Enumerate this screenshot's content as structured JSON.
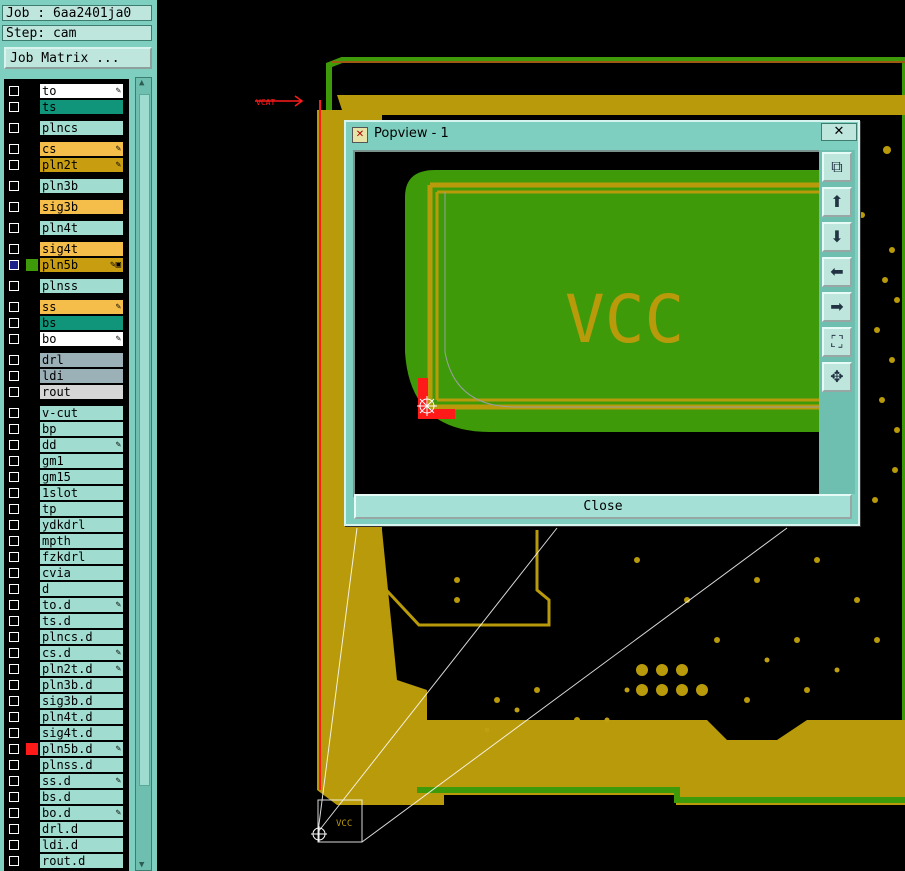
{
  "job_label": "Job : 6aa2401ja0",
  "step_label": "Step: cam",
  "job_matrix_button": "Job Matrix ...",
  "layers": [
    {
      "name": "to",
      "color": "#ffffff",
      "swatch": "",
      "flag": "✎"
    },
    {
      "name": "ts",
      "color": "#10957a",
      "swatch": "",
      "flag": ""
    },
    {
      "name": "plncs",
      "color": "#a0dcd0",
      "swatch": "",
      "flag": ""
    },
    {
      "name": "cs",
      "color": "#f5be4b",
      "swatch": "",
      "flag": "✎"
    },
    {
      "name": "pln2t",
      "color": "#c99d10",
      "swatch": "",
      "flag": "✎"
    },
    {
      "name": "pln3b",
      "color": "#a0dcd0",
      "swatch": "",
      "flag": ""
    },
    {
      "name": "sig3b",
      "color": "#f5be4b",
      "swatch": "",
      "flag": ""
    },
    {
      "name": "pln4t",
      "color": "#a0dcd0",
      "swatch": "",
      "flag": ""
    },
    {
      "name": "sig4t",
      "color": "#f5be4b",
      "swatch": "",
      "flag": ""
    },
    {
      "name": "pln5b",
      "color": "#c99d10",
      "swatch": "#3f9a0a",
      "flag": "✎▣",
      "selected": true
    },
    {
      "name": "plnss",
      "color": "#a0dcd0",
      "swatch": "",
      "flag": ""
    },
    {
      "name": "ss",
      "color": "#f5be4b",
      "swatch": "",
      "flag": "✎"
    },
    {
      "name": "bs",
      "color": "#10957a",
      "swatch": "",
      "flag": ""
    },
    {
      "name": "bo",
      "color": "#ffffff",
      "swatch": "",
      "flag": "✎"
    },
    {
      "name": "drl",
      "color": "#9cb0b8",
      "swatch": "",
      "flag": ""
    },
    {
      "name": "ldi",
      "color": "#9cb0b8",
      "swatch": "",
      "flag": ""
    },
    {
      "name": "rout",
      "color": "#d6d6d6",
      "swatch": "",
      "flag": ""
    },
    {
      "name": "v-cut",
      "color": "#a0dcd0",
      "swatch": "",
      "flag": ""
    },
    {
      "name": "bp",
      "color": "#a0dcd0",
      "swatch": "",
      "flag": ""
    },
    {
      "name": "dd",
      "color": "#a0dcd0",
      "swatch": "",
      "flag": "✎"
    },
    {
      "name": "gm1",
      "color": "#a0dcd0",
      "swatch": "",
      "flag": ""
    },
    {
      "name": "gm15",
      "color": "#a0dcd0",
      "swatch": "",
      "flag": ""
    },
    {
      "name": "1slot",
      "color": "#a0dcd0",
      "swatch": "",
      "flag": ""
    },
    {
      "name": "tp",
      "color": "#a0dcd0",
      "swatch": "",
      "flag": ""
    },
    {
      "name": "ydkdrl",
      "color": "#a0dcd0",
      "swatch": "",
      "flag": ""
    },
    {
      "name": "mpth",
      "color": "#a0dcd0",
      "swatch": "",
      "flag": ""
    },
    {
      "name": "fzkdrl",
      "color": "#a0dcd0",
      "swatch": "",
      "flag": ""
    },
    {
      "name": "cvia",
      "color": "#a0dcd0",
      "swatch": "",
      "flag": ""
    },
    {
      "name": "d",
      "color": "#a0dcd0",
      "swatch": "",
      "flag": ""
    },
    {
      "name": "to.d",
      "color": "#a0dcd0",
      "swatch": "",
      "flag": "✎"
    },
    {
      "name": "ts.d",
      "color": "#a0dcd0",
      "swatch": "",
      "flag": ""
    },
    {
      "name": "plncs.d",
      "color": "#a0dcd0",
      "swatch": "",
      "flag": ""
    },
    {
      "name": "cs.d",
      "color": "#a0dcd0",
      "swatch": "",
      "flag": "✎"
    },
    {
      "name": "pln2t.d",
      "color": "#a0dcd0",
      "swatch": "",
      "flag": "✎"
    },
    {
      "name": "pln3b.d",
      "color": "#a0dcd0",
      "swatch": "",
      "flag": ""
    },
    {
      "name": "sig3b.d",
      "color": "#a0dcd0",
      "swatch": "",
      "flag": ""
    },
    {
      "name": "pln4t.d",
      "color": "#a0dcd0",
      "swatch": "",
      "flag": ""
    },
    {
      "name": "sig4t.d",
      "color": "#a0dcd0",
      "swatch": "",
      "flag": ""
    },
    {
      "name": "pln5b.d",
      "color": "#a0dcd0",
      "swatch": "#ff1a1a",
      "flag": "✎"
    },
    {
      "name": "plnss.d",
      "color": "#a0dcd0",
      "swatch": "",
      "flag": ""
    },
    {
      "name": "ss.d",
      "color": "#a0dcd0",
      "swatch": "",
      "flag": "✎"
    },
    {
      "name": "bs.d",
      "color": "#a0dcd0",
      "swatch": "",
      "flag": ""
    },
    {
      "name": "bo.d",
      "color": "#a0dcd0",
      "swatch": "",
      "flag": "✎"
    },
    {
      "name": "drl.d",
      "color": "#a0dcd0",
      "swatch": "",
      "flag": ""
    },
    {
      "name": "ldi.d",
      "color": "#a0dcd0",
      "swatch": "",
      "flag": ""
    },
    {
      "name": "rout.d",
      "color": "#a0dcd0",
      "swatch": "",
      "flag": ""
    }
  ],
  "canvas": {
    "net_label_small": "VCAT",
    "net_label_corner": "VCC",
    "colors": {
      "copper": "#b89a0a",
      "plane": "#3f9a0a",
      "outline": "#ff1a1a",
      "background": "#000000"
    }
  },
  "popview": {
    "title": "Popview - 1",
    "close_x": "✕",
    "net_label": "VCC",
    "close_button": "Close",
    "tools": [
      "zoom-box-icon",
      "pan-up-icon",
      "pan-down-icon",
      "pan-left-icon",
      "pan-right-icon",
      "zoom-fit-icon",
      "zoom-home-icon"
    ]
  }
}
